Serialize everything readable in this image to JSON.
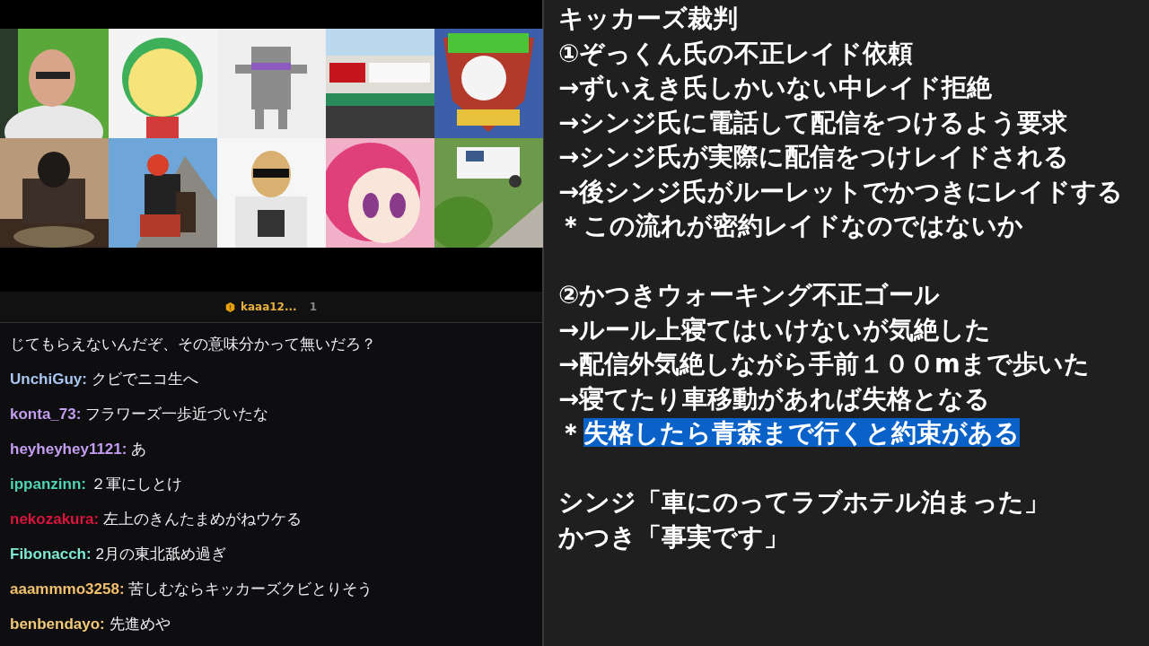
{
  "chat_header": {
    "user": "kaaa12...",
    "count": "1"
  },
  "chat": [
    {
      "kind": "continuation",
      "text": "じてもらえないんだぞ、その意味分かって無いだろ？"
    },
    {
      "kind": "message",
      "user": "UnchiGuy:",
      "color": "#a9c6f2",
      "text": "クビでニコ生へ"
    },
    {
      "kind": "message",
      "user": "konta_73:",
      "color": "#c39df0",
      "text": "フラワーズ一歩近づいたな"
    },
    {
      "kind": "message",
      "user": "heyheyhey1121:",
      "color": "#c39df0",
      "text": "あ"
    },
    {
      "kind": "message",
      "user": "ippanzinn:",
      "color": "#4fd3b2",
      "text": "２軍にしとけ"
    },
    {
      "kind": "message",
      "user": "nekozakura:",
      "color": "#d8153c",
      "text": "左上のきんたまめがねウケる"
    },
    {
      "kind": "message",
      "user": "Fibonacch:",
      "color": "#7ee9d2",
      "text": "2月の東北舐め過ぎ"
    },
    {
      "kind": "message",
      "user": "aaammmo3258:",
      "color": "#f2c06c",
      "text": "苦しむならキッカーズクビとりそう"
    },
    {
      "kind": "message",
      "user": "benbendayo:",
      "color": "#f2c87a",
      "text": "先進めや"
    }
  ],
  "notes": {
    "paragraphs": [
      {
        "lines": [
          [
            {
              "text": "キッカーズ裁判",
              "highlighted": false
            }
          ],
          [
            {
              "text": "①ぞっくん氏の不正レイド依頼",
              "highlighted": false
            }
          ],
          [
            {
              "text": "→ずいえき氏しかいない中レイド拒絶",
              "highlighted": false
            }
          ],
          [
            {
              "text": "→シンジ氏に電話して配信をつけるよう要求",
              "highlighted": false
            }
          ],
          [
            {
              "text": "→シンジ氏が実際に配信をつけレイドされる",
              "highlighted": false
            }
          ],
          [
            {
              "text": "→後シンジ氏がルーレットでかつきにレイドする",
              "highlighted": false
            }
          ],
          [
            {
              "text": "＊この流れが密約レイドなのではないか",
              "highlighted": false
            }
          ]
        ]
      },
      {
        "lines": [
          [
            {
              "text": "②かつきウォーキング不正ゴール",
              "highlighted": false
            }
          ],
          [
            {
              "text": "→ルール上寝てはいけないが気絶した",
              "highlighted": false
            }
          ],
          [
            {
              "text": "→配信外気絶しながら手前１００mまで歩いた",
              "highlighted": false
            }
          ],
          [
            {
              "text": "→寝てたり車移動があれば失格となる",
              "highlighted": false
            }
          ],
          [
            {
              "text": "＊",
              "highlighted": false
            },
            {
              "text": "失格したら青森まで行くと約束がある",
              "highlighted": true
            }
          ]
        ]
      },
      {
        "lines": [
          [
            {
              "text": "シンジ「車にのってラブホテル泊まった」",
              "highlighted": false
            }
          ],
          [
            {
              "text": "かつき「事実です」",
              "highlighted": false
            }
          ]
        ]
      }
    ]
  }
}
